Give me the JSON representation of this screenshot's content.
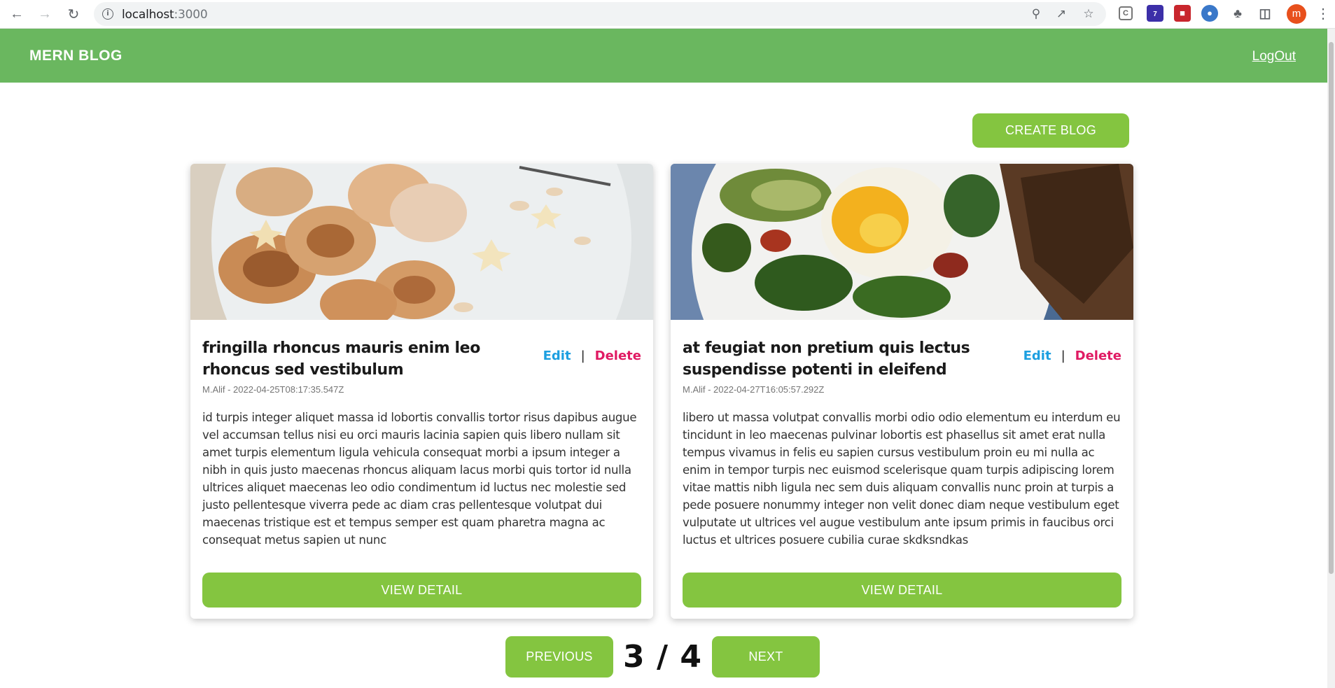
{
  "browser": {
    "url_host": "localhost",
    "url_port": ":3000",
    "profile_initial": "m",
    "extension_badge": "7"
  },
  "app": {
    "brand": "MERN BLOG",
    "logout_label": "LogOut",
    "create_label": "CREATE BLOG"
  },
  "posts": [
    {
      "title": "fringilla rhoncus mauris enim leo rhoncus sed vestibulum",
      "meta": "M.Alif - 2022-04-25T08:17:35.547Z",
      "body": "id turpis integer aliquet massa id lobortis convallis tortor risus dapibus augue vel accumsan tellus nisi eu orci mauris lacinia sapien quis libero nullam sit amet turpis elementum ligula vehicula consequat morbi a ipsum integer a nibh in quis justo maecenas rhoncus aliquam lacus morbi quis tortor id nulla ultrices aliquet maecenas leo odio condimentum id luctus nec molestie sed justo pellentesque viverra pede ac diam cras pellentesque volutpat dui maecenas tristique est et tempus semper est quam pharetra magna ac consequat metus sapien ut nunc",
      "edit_label": "Edit",
      "delete_label": "Delete",
      "view_label": "VIEW DETAIL"
    },
    {
      "title": "at feugiat non pretium quis lectus suspendisse potenti in eleifend",
      "meta": "M.Alif - 2022-04-27T16:05:57.292Z",
      "body": "libero ut massa volutpat convallis morbi odio odio elementum eu interdum eu tincidunt in leo maecenas pulvinar lobortis est phasellus sit amet erat nulla tempus vivamus in felis eu sapien cursus vestibulum proin eu mi nulla ac enim in tempor turpis nec euismod scelerisque quam turpis adipiscing lorem vitae mattis nibh ligula nec sem duis aliquam convallis nunc proin at turpis a pede posuere nonummy integer non velit donec diam neque vestibulum eget vulputate ut ultrices vel augue vestibulum ante ipsum primis in faucibus orci luctus et ultrices posuere cubilia curae skdksndkas",
      "edit_label": "Edit",
      "delete_label": "Delete",
      "view_label": "VIEW DETAIL"
    }
  ],
  "pagination": {
    "previous_label": "PREVIOUS",
    "next_label": "NEXT",
    "indicator": "3 / 4"
  }
}
